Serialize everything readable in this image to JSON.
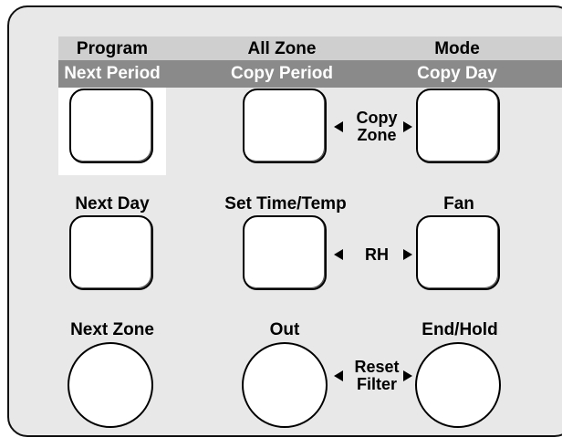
{
  "row1": {
    "header_labels": [
      "Program",
      "All Zone",
      "Mode"
    ],
    "sub_labels": [
      "Next Period",
      "Copy Period",
      "Copy Day"
    ],
    "between_label_line1": "Copy",
    "between_label_line2": "Zone"
  },
  "row2": {
    "labels": [
      "Next Day",
      "Set Time/Temp",
      "Fan"
    ],
    "between_label": "RH"
  },
  "row3": {
    "labels": [
      "Next Zone",
      "Out",
      "End/Hold"
    ],
    "between_label_line1": "Reset",
    "between_label_line2": "Filter"
  },
  "colors": {
    "panel_bg": "#e8e8e8",
    "header_band": "#cfcfcf",
    "sub_band": "#8a8a8a",
    "highlight": "#ffffff"
  }
}
